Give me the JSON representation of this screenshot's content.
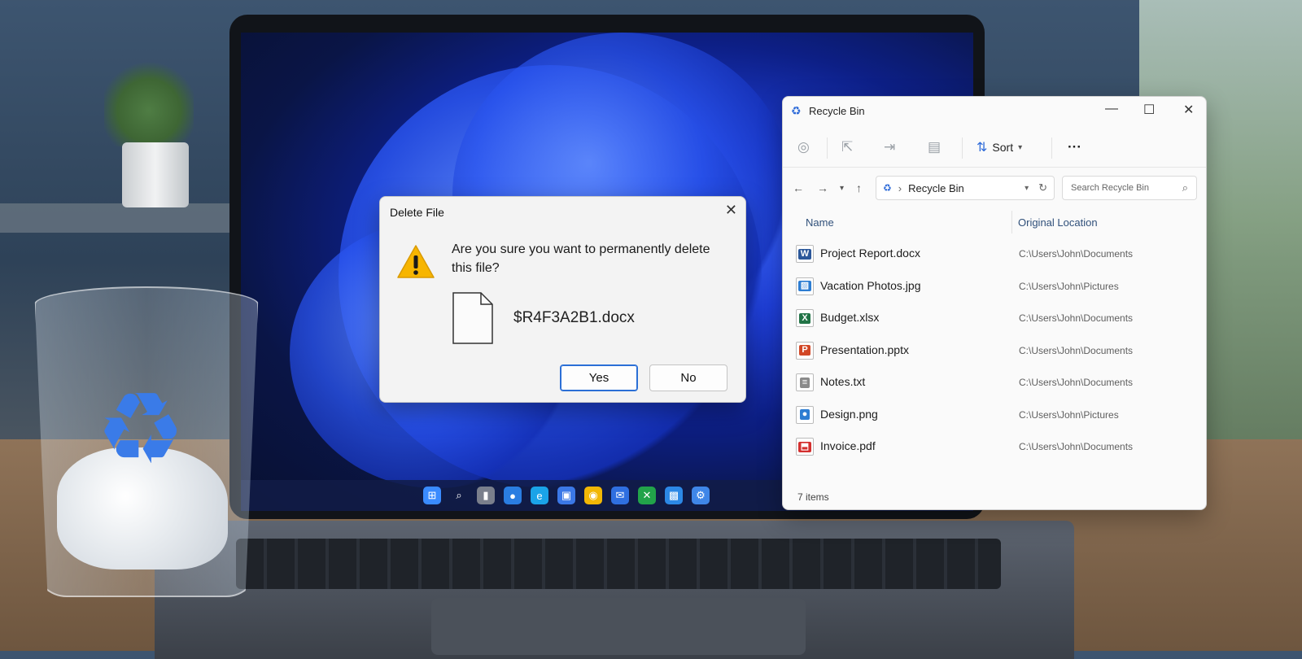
{
  "dialog": {
    "title": "Delete File",
    "close_glyph": "✕",
    "message": "Are you sure you want to permanently delete this file?",
    "file_name": "$R4F3A2B1.docx",
    "yes_label": "Yes",
    "no_label": "No"
  },
  "explorer": {
    "title": "Recycle Bin",
    "window_controls": {
      "minimize": "—",
      "maximize": "☐",
      "close": "✕"
    },
    "toolbar": {
      "sort_label": "Sort",
      "more_label": "···"
    },
    "address": "Recycle Bin",
    "search_placeholder": "Search Recycle Bin",
    "columns": {
      "name": "Name",
      "location": "Original Location"
    },
    "items": [
      {
        "name": "Project Report.docx",
        "location": "C:\\Users\\John\\Documents",
        "icon": "word-icon",
        "color": "#2b579a"
      },
      {
        "name": "Vacation Photos.jpg",
        "location": "C:\\Users\\John\\Pictures",
        "icon": "image-icon",
        "color": "#2d7dd2"
      },
      {
        "name": "Budget.xlsx",
        "location": "C:\\Users\\John\\Documents",
        "icon": "excel-icon",
        "color": "#217346"
      },
      {
        "name": "Presentation.pptx",
        "location": "C:\\Users\\John\\Documents",
        "icon": "powerpoint-icon",
        "color": "#d24726"
      },
      {
        "name": "Notes.txt",
        "location": "C:\\Users\\John\\Documents",
        "icon": "text-file-icon",
        "color": "#8a8a8a"
      },
      {
        "name": "Design.png",
        "location": "C:\\Users\\John\\Pictures",
        "icon": "png-icon",
        "color": "#2d7dd2"
      },
      {
        "name": "Invoice.pdf",
        "location": "C:\\Users\\John\\Documents",
        "icon": "pdf-icon",
        "color": "#d3302f"
      }
    ],
    "status": "7 items"
  },
  "colors": {
    "accent": "#2b6fd6",
    "wallpaper": "#1f3fd9",
    "recycle_logo": "#3a7be8"
  }
}
